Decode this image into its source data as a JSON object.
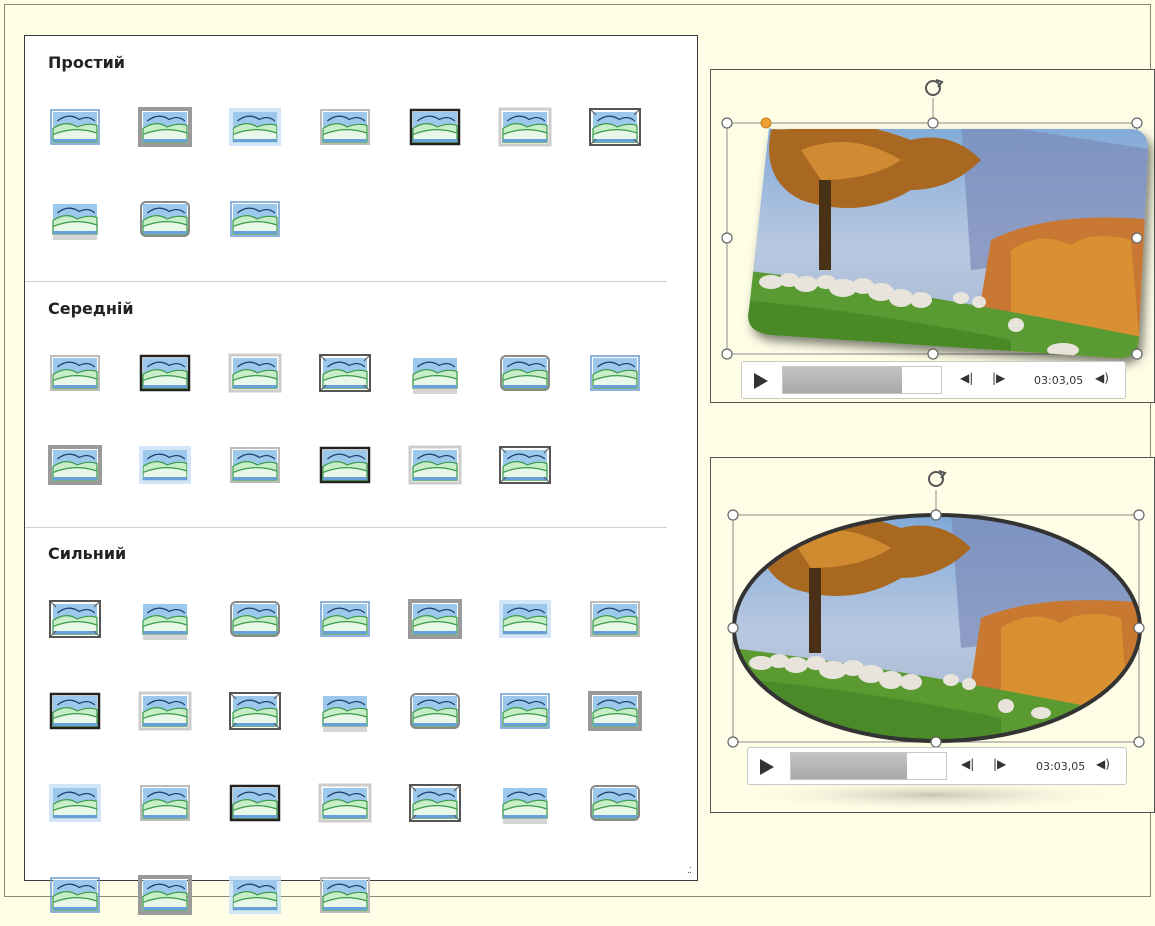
{
  "sections": [
    {
      "id": "simple",
      "title": "Простий",
      "count": 10
    },
    {
      "id": "medium",
      "title": "Середній",
      "count": 13
    },
    {
      "id": "strong",
      "title": "Сильний",
      "count": 25
    }
  ],
  "player": {
    "time": "03:03,05",
    "progress": 0.75
  },
  "colors": {
    "sky": "#9cc8ec",
    "hill_light": "#c8eec8",
    "hill_dark": "#3a9a4a",
    "outline": "#1a3a6a",
    "handle_accent": "#f0a030"
  },
  "icons": {
    "play": "play-icon",
    "step_back": "step-back-icon",
    "step_forward": "step-forward-icon",
    "volume": "volume-icon",
    "rotate": "rotate-handle-icon"
  }
}
